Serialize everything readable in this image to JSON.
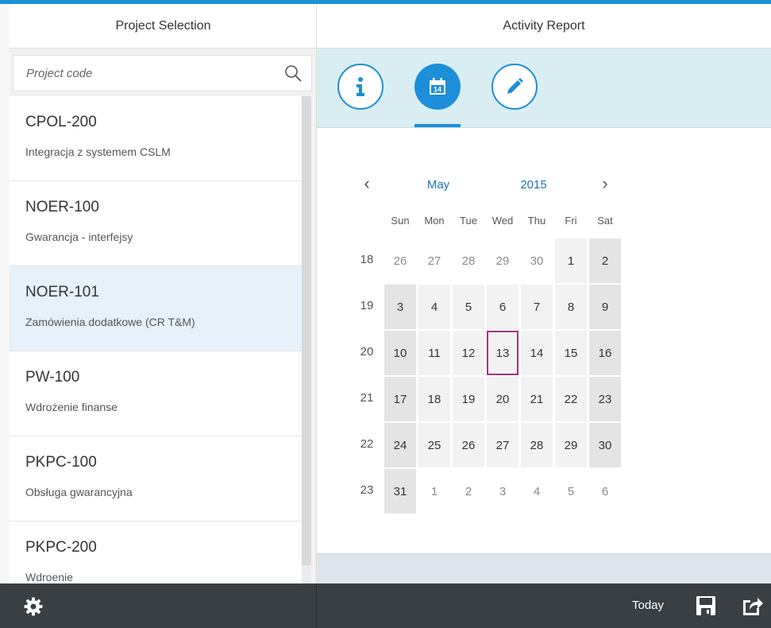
{
  "left": {
    "title": "Project Selection",
    "search_placeholder": "Project code",
    "projects": [
      {
        "code": "CPOL-200",
        "desc": "Integracja z systemem CSLM",
        "selected": false
      },
      {
        "code": "NOER-100",
        "desc": "Gwarancja - interfejsy",
        "selected": false
      },
      {
        "code": "NOER-101",
        "desc": "Zamówienia dodatkowe (CR T&M)",
        "selected": true
      },
      {
        "code": "PW-100",
        "desc": "Wdrożenie finanse",
        "selected": false
      },
      {
        "code": "PKPC-100",
        "desc": "Obsługa gwarancyjna",
        "selected": false
      },
      {
        "code": "PKPC-200",
        "desc": "Wdroenie",
        "selected": false
      }
    ]
  },
  "right": {
    "title": "Activity Report",
    "tabs": [
      {
        "icon": "info-icon",
        "active": false
      },
      {
        "icon": "calendar-icon",
        "active": true,
        "day": "14"
      },
      {
        "icon": "pencil-icon",
        "active": false
      }
    ]
  },
  "calendar": {
    "month": "May",
    "year": "2015",
    "weekdays": [
      "Sun",
      "Mon",
      "Tue",
      "Wed",
      "Thu",
      "Fri",
      "Sat"
    ],
    "weeks": [
      {
        "num": "18",
        "days": [
          "26",
          "27",
          "28",
          "29",
          "30",
          "1",
          "2"
        ],
        "current": [
          false,
          false,
          false,
          false,
          false,
          true,
          true
        ]
      },
      {
        "num": "19",
        "days": [
          "3",
          "4",
          "5",
          "6",
          "7",
          "8",
          "9"
        ],
        "current": [
          true,
          true,
          true,
          true,
          true,
          true,
          true
        ]
      },
      {
        "num": "20",
        "days": [
          "10",
          "11",
          "12",
          "13",
          "14",
          "15",
          "16"
        ],
        "current": [
          true,
          true,
          true,
          true,
          true,
          true,
          true
        ]
      },
      {
        "num": "21",
        "days": [
          "17",
          "18",
          "19",
          "20",
          "21",
          "22",
          "23"
        ],
        "current": [
          true,
          true,
          true,
          true,
          true,
          true,
          true
        ]
      },
      {
        "num": "22",
        "days": [
          "24",
          "25",
          "26",
          "27",
          "28",
          "29",
          "30"
        ],
        "current": [
          true,
          true,
          true,
          true,
          true,
          true,
          true
        ]
      },
      {
        "num": "23",
        "days": [
          "31",
          "1",
          "2",
          "3",
          "4",
          "5",
          "6"
        ],
        "current": [
          true,
          false,
          false,
          false,
          false,
          false,
          false
        ]
      }
    ],
    "today": "13"
  },
  "footer": {
    "today_label": "Today",
    "settings_icon": "gear-icon",
    "save_icon": "save-icon",
    "share_icon": "share-icon"
  },
  "colors": {
    "accent": "#1c8fd8",
    "selected_row": "#e6f1fa",
    "today_outline": "#a2327f",
    "footer_bg": "#3a3f44",
    "tabbar_bg": "#d9eef2"
  }
}
